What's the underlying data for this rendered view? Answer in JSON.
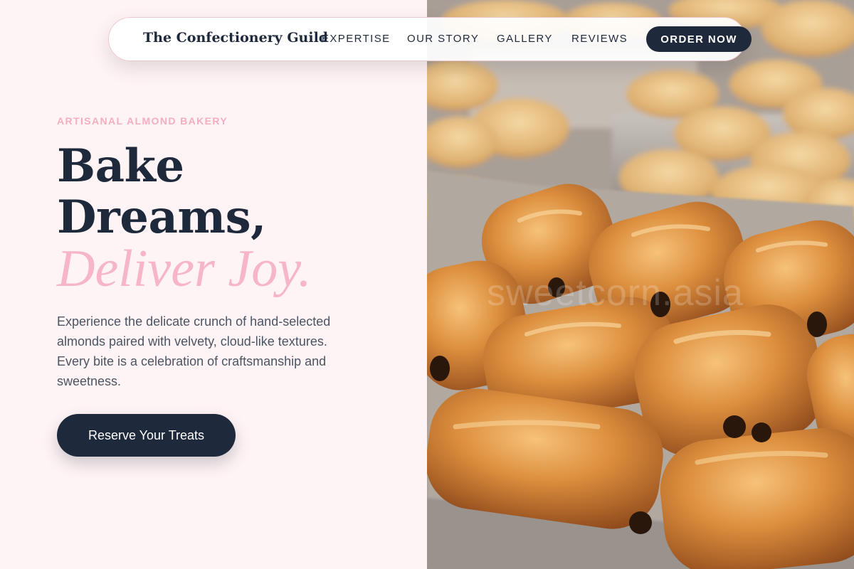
{
  "nav": {
    "brand": "The Confectionery Guild",
    "links": [
      "EXPERTISE",
      "OUR STORY",
      "GALLERY",
      "REVIEWS"
    ],
    "cta_label": "ORDER NOW"
  },
  "hero": {
    "eyebrow": "ARTISANAL ALMOND BAKERY",
    "headline_line1": "Bake",
    "headline_line2": "Dreams,",
    "headline_accent": "Deliver Joy.",
    "description": "Experience the delicate crunch of hand-selected almonds paired with velvety, cloud-like textures. Every bite is a celebration of craftsmanship and sweetness.",
    "cta_label": "Reserve Your Treats"
  },
  "image": {
    "alt": "Trays of freshly baked chocolate croissants and egg tarts",
    "watermark": "sweetcorn.asia"
  },
  "colors": {
    "background": "#fff4f5",
    "navy": "#1e293b",
    "pink_accent": "#f6b6c8",
    "eyebrow_pink": "#f4aebf",
    "body_text": "#4b5563"
  }
}
